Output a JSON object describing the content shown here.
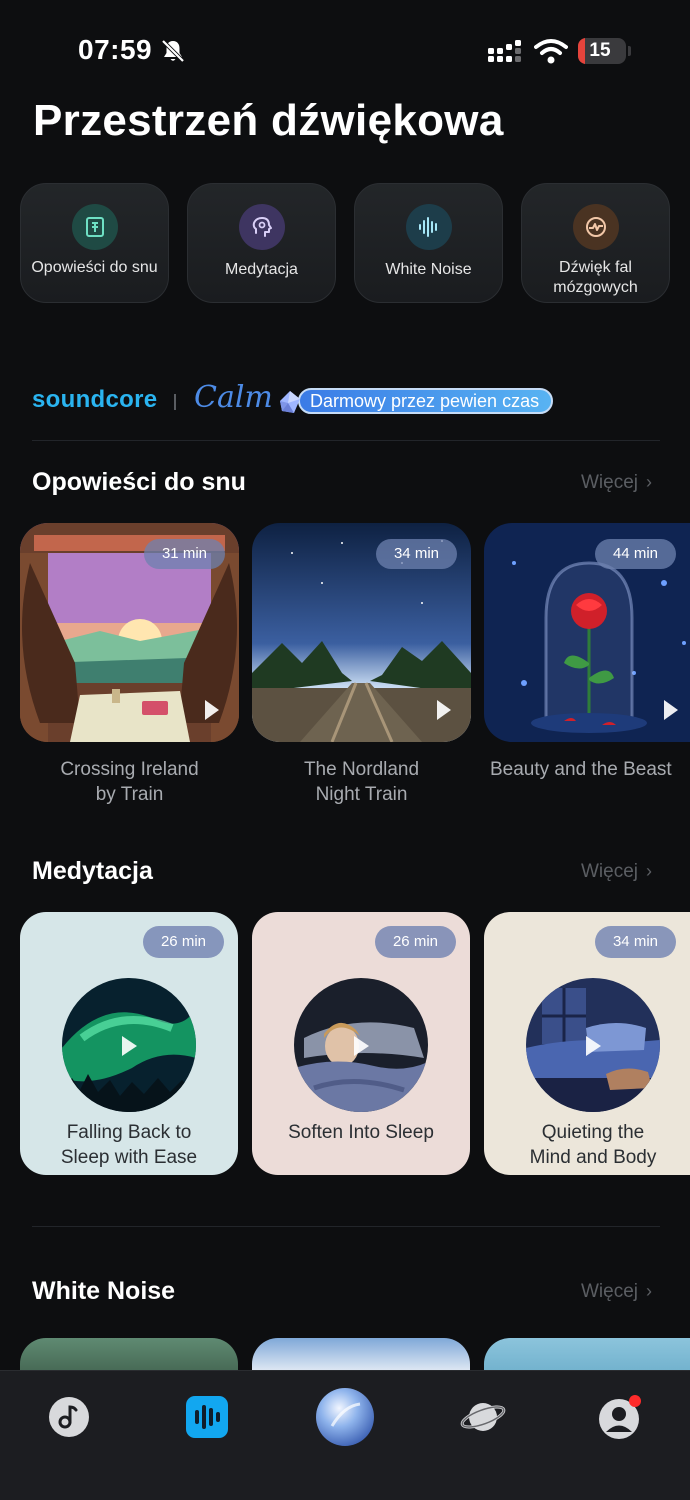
{
  "status": {
    "time": "07:59",
    "battery": "15",
    "icons": [
      "bell-slash-icon",
      "signal-icon",
      "wifi-icon",
      "battery-icon"
    ]
  },
  "page": {
    "title": "Przestrzeń dźwiękowa"
  },
  "categories": [
    {
      "label": "Opowieści do snu",
      "icon": "book-icon",
      "color": "#1f4a44"
    },
    {
      "label": "Medytacja",
      "icon": "head-icon",
      "color": "#3e3561"
    },
    {
      "label": "White Noise",
      "icon": "waveform-icon",
      "color": "#1d3d4a"
    },
    {
      "label": "Dźwięk fal mózgowych",
      "icon": "brainwave-icon",
      "color": "#4a3322"
    }
  ],
  "banner": {
    "brand": "soundcore",
    "partner": "Calm",
    "promo": "Darmowy przez pewien czas"
  },
  "sections": {
    "stories": {
      "title": "Opowieści do snu",
      "more": "Więcej"
    },
    "meditation": {
      "title": "Medytacja",
      "more": "Więcej"
    },
    "white_noise": {
      "title": "White Noise",
      "more": "Więcej"
    }
  },
  "stories": [
    {
      "title_line1": "Crossing Ireland",
      "title_line2": "by Train",
      "duration": "31 min"
    },
    {
      "title_line1": "The Nordland",
      "title_line2": "Night Train",
      "duration": "34 min"
    },
    {
      "title_line1": "Beauty and the Beast",
      "title_line2": "",
      "duration": "44 min"
    }
  ],
  "meditations": [
    {
      "title_line1": "Falling Back to",
      "title_line2": "Sleep with Ease",
      "duration": "26 min",
      "bg": "#d6e6e8"
    },
    {
      "title_line1": "Soften Into Sleep",
      "title_line2": "",
      "duration": "26 min",
      "bg": "#ecdcd8"
    },
    {
      "title_line1": "Quieting the",
      "title_line2": "Mind and Body",
      "duration": "34 min",
      "bg": "#ece6da"
    }
  ],
  "tabs": [
    "music-note-icon",
    "soundspace-icon",
    "orb-icon",
    "planet-icon",
    "profile-icon"
  ]
}
